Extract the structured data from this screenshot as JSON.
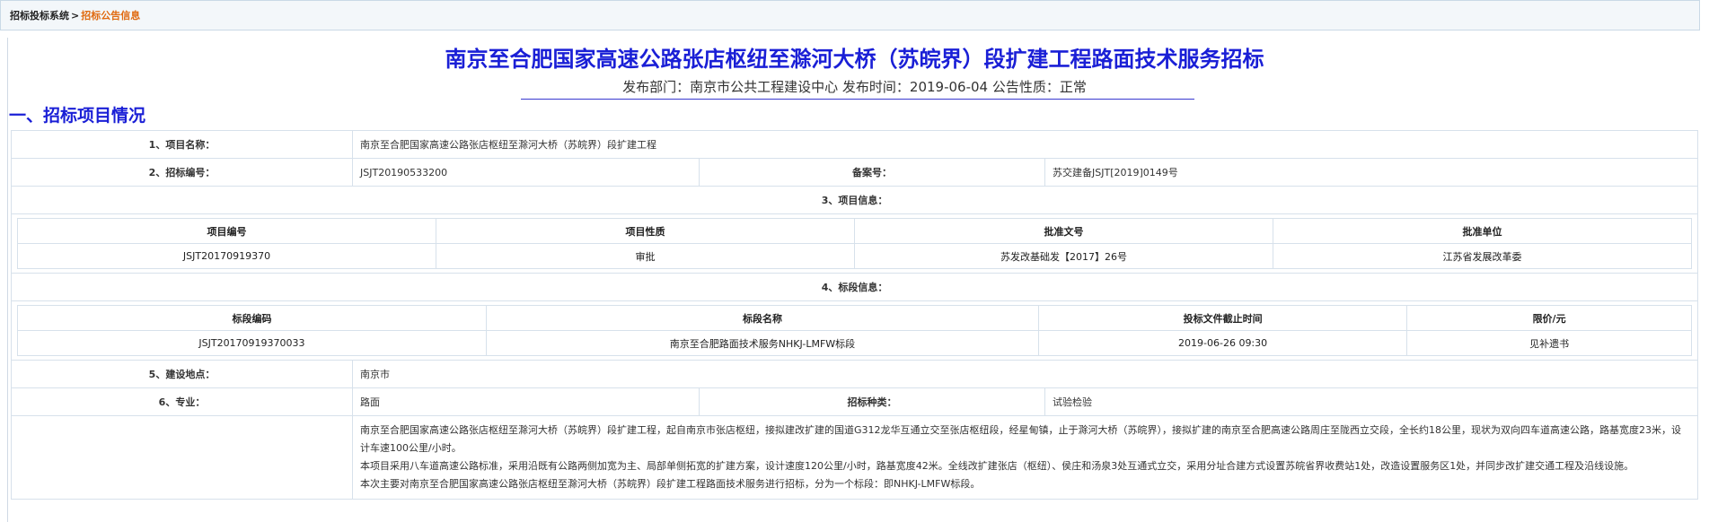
{
  "breadcrumb": {
    "root": "招标投标系统",
    "separator": ">",
    "current": "招标公告信息"
  },
  "title": "南京至合肥国家高速公路张店枢纽至滁河大桥（苏皖界）段扩建工程路面技术服务招标",
  "meta": "发布部门：南京市公共工程建设中心 发布时间：2019-06-04 公告性质：正常",
  "section_heading": "一、招标项目情况",
  "rows": {
    "project_name_label": "1、项目名称：",
    "project_name": "南京至合肥国家高速公路张店枢纽至滁河大桥（苏皖界）段扩建工程",
    "bid_no_label": "2、招标编号：",
    "bid_no": "JSJT20190533200",
    "record_no_label": "备案号：",
    "record_no": "苏交建备JSJT[2019]0149号",
    "project_info_label": "3、项目信息：",
    "lot_info_label": "4、标段信息：",
    "location_label": "5、建设地点：",
    "location": "南京市",
    "specialty_label": "6、专业：",
    "specialty": "路面",
    "bid_type_label": "招标种类：",
    "bid_type": "试验检验"
  },
  "project_table": {
    "headers": [
      "项目编号",
      "项目性质",
      "批准文号",
      "批准单位"
    ],
    "row": [
      "JSJT20170919370",
      "审批",
      "苏发改基础发【2017】26号",
      "江苏省发展改革委"
    ]
  },
  "lot_table": {
    "headers": [
      "标段编码",
      "标段名称",
      "投标文件截止时间",
      "限价/元"
    ],
    "row": [
      "JSJT20170919370033",
      "南京至合肥路面技术服务NHKJ-LMFW标段",
      "2019-06-26 09:30",
      "见补遗书"
    ]
  },
  "description": {
    "p1": "南京至合肥国家高速公路张店枢纽至滁河大桥（苏皖界）段扩建工程，起自南京市张店枢纽，接拟建改扩建的国道G312龙华互通立交至张店枢纽段，经星甸镇，止于滁河大桥（苏皖界），接拟扩建的南京至合肥高速公路周庄至陇西立交段，全长约18公里，现状为双向四车道高速公路，路基宽度23米，设计车速100公里/小时。",
    "p2": "本项目采用八车道高速公路标准，采用沿既有公路两侧加宽为主、局部单侧拓宽的扩建方案，设计速度120公里/小时，路基宽度42米。全线改扩建张店（枢纽）、侯庄和汤泉3处互通式立交，采用分址合建方式设置苏皖省界收费站1处，改造设置服务区1处，并同步改扩建交通工程及沿线设施。",
    "p3": "本次主要对南京至合肥国家高速公路张店枢纽至滁河大桥（苏皖界）段扩建工程路面技术服务进行招标，分为一个标段：即NHKJ-LMFW标段。"
  }
}
